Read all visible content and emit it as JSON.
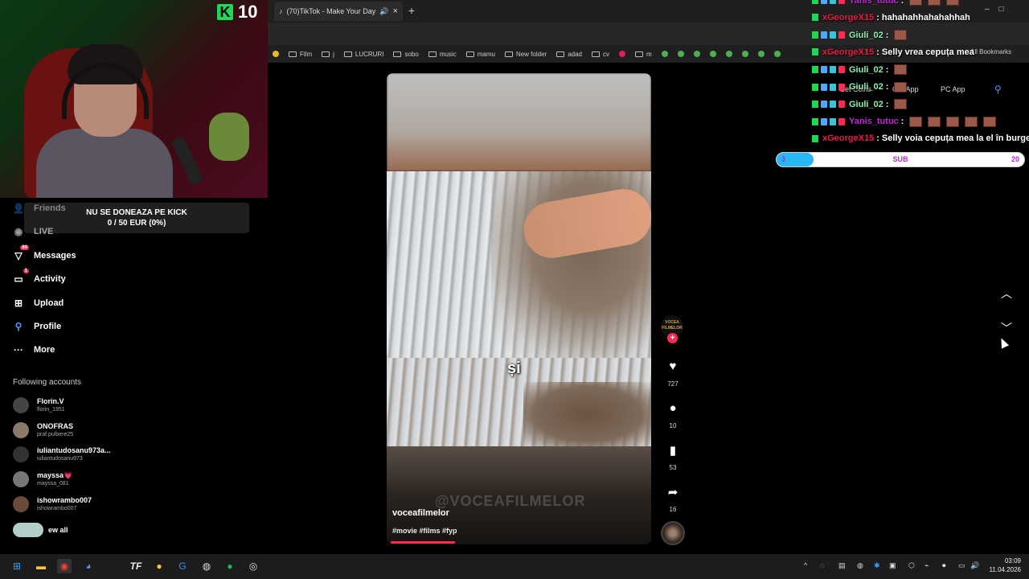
{
  "browser": {
    "tab_title": "(70)TikTok - Make Your Day",
    "bookmarks": [
      "Film",
      "j",
      "LUCRURI",
      "sobo",
      "music",
      "mamu",
      "New folder",
      "adad",
      "cv",
      "m"
    ],
    "all_bookmarks": "All Bookmarks"
  },
  "stream": {
    "viewer_count": "10",
    "donation_title": "NU SE DONEAZA PE KICK",
    "donation_progress": "0 / 50 EUR (0%)",
    "donation_fraction": 0.0
  },
  "sidebar": {
    "nav": [
      {
        "label": "Friends",
        "icon": "friends-icon"
      },
      {
        "label": "LIVE",
        "icon": "live-icon"
      },
      {
        "label": "Messages",
        "icon": "messages-icon",
        "badge": "69"
      },
      {
        "label": "Activity",
        "icon": "activity-icon",
        "badge": "1"
      },
      {
        "label": "Upload",
        "icon": "upload-icon"
      },
      {
        "label": "Profile",
        "icon": "profile-icon"
      },
      {
        "label": "More",
        "icon": "more-icon"
      }
    ],
    "following_title": "Following accounts",
    "accounts": [
      {
        "name": "Florin.V",
        "handle": "florin_1951"
      },
      {
        "name": "ONOFRAS",
        "handle": "praf.pulbere25"
      },
      {
        "name": "iuliantudosanu973a...",
        "handle": "iuliantudosanu973"
      },
      {
        "name": "mayssa💗",
        "handle": "mayssa_081"
      },
      {
        "name": "ishowrambo007",
        "handle": "ishowrambo007"
      }
    ],
    "see_all": "ew all"
  },
  "video": {
    "subtitle": "și",
    "watermark": "@VOCEAFILMELOR",
    "author": "voceafilmelor",
    "tags": "#movie #films #fyp",
    "creator_badge": "VOCEA FILMELOR",
    "likes": "727",
    "comments": "10",
    "saves": "53",
    "shares": "16",
    "progress_fraction": 0.25
  },
  "header": {
    "get_coins": "Get Coins",
    "get_app": "Get App",
    "pc_app": "PC App"
  },
  "chat": [
    {
      "user": "Yanis_tutuc",
      "color": "#c026d3",
      "message": "",
      "emotes": 3
    },
    {
      "user": "xGeorgeX15",
      "color": "#e11d48",
      "message": "hahahahhahahahhah",
      "emotes": 0
    },
    {
      "user": "Giuli_02",
      "color": "#86efac",
      "message": "",
      "emotes": 1
    },
    {
      "user": "xGeorgeX15",
      "color": "#e11d48",
      "message": "Selly vrea cepuța mea",
      "emotes": 0
    },
    {
      "user": "Giuli_02",
      "color": "#86efac",
      "message": "",
      "emotes": 1
    },
    {
      "user": "Giuli_02",
      "color": "#86efac",
      "message": "",
      "emotes": 1
    },
    {
      "user": "Giuli_02",
      "color": "#86efac",
      "message": "",
      "emotes": 1
    },
    {
      "user": "Yanis_tutuc",
      "color": "#c026d3",
      "message": "",
      "emotes": 5
    },
    {
      "user": "xGeorgeX15",
      "color": "#e11d48",
      "message": "Selly voia cepuța mea la el în burge",
      "emotes": 0
    }
  ],
  "sub_goal": {
    "current": "3",
    "label": "SUB",
    "goal": "20",
    "fraction": 0.15
  },
  "taskbar": {
    "time": "03:09",
    "date": "11.04.2026"
  },
  "colors": {
    "tiktok_red": "#fe2c55",
    "kick_green": "#1fd655",
    "sub_bar": "#29b6f6"
  }
}
